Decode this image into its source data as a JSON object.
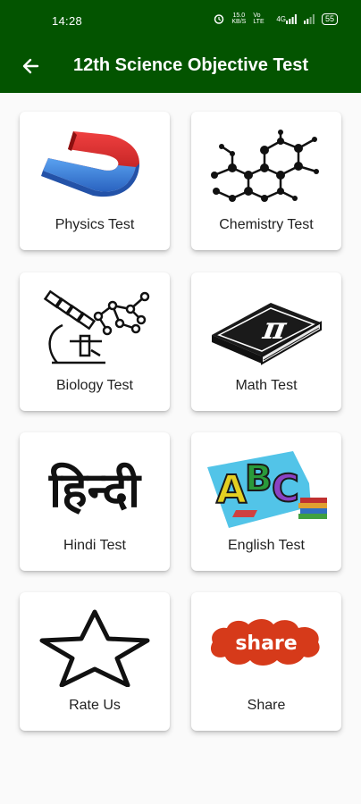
{
  "status_bar": {
    "time": "14:28",
    "net_speed_top": "15.0",
    "net_speed_unit": "KB/S",
    "network_label": "Vo LTE",
    "signal_label": "4G",
    "battery": "55"
  },
  "app_bar": {
    "title": "12th Science Objective Test",
    "back_icon": "arrow-back-icon",
    "background": "#035400"
  },
  "menu": {
    "items": [
      {
        "label": "Physics Test",
        "icon": "magnet-icon"
      },
      {
        "label": "Chemistry Test",
        "icon": "molecule-icon"
      },
      {
        "label": "Biology Test",
        "icon": "microscope-icon"
      },
      {
        "label": "Math Test",
        "icon": "pi-book-icon"
      },
      {
        "label": "Hindi Test",
        "icon": "hindi-script-icon",
        "icon_text": "हिन्दी"
      },
      {
        "label": "English Test",
        "icon": "abc-letters-icon"
      },
      {
        "label": "Rate Us",
        "icon": "star-icon"
      },
      {
        "label": "Share",
        "icon": "share-badge-icon",
        "icon_text": "share"
      }
    ]
  },
  "colors": {
    "accent": "#035400",
    "share_red": "#d63a1a"
  }
}
